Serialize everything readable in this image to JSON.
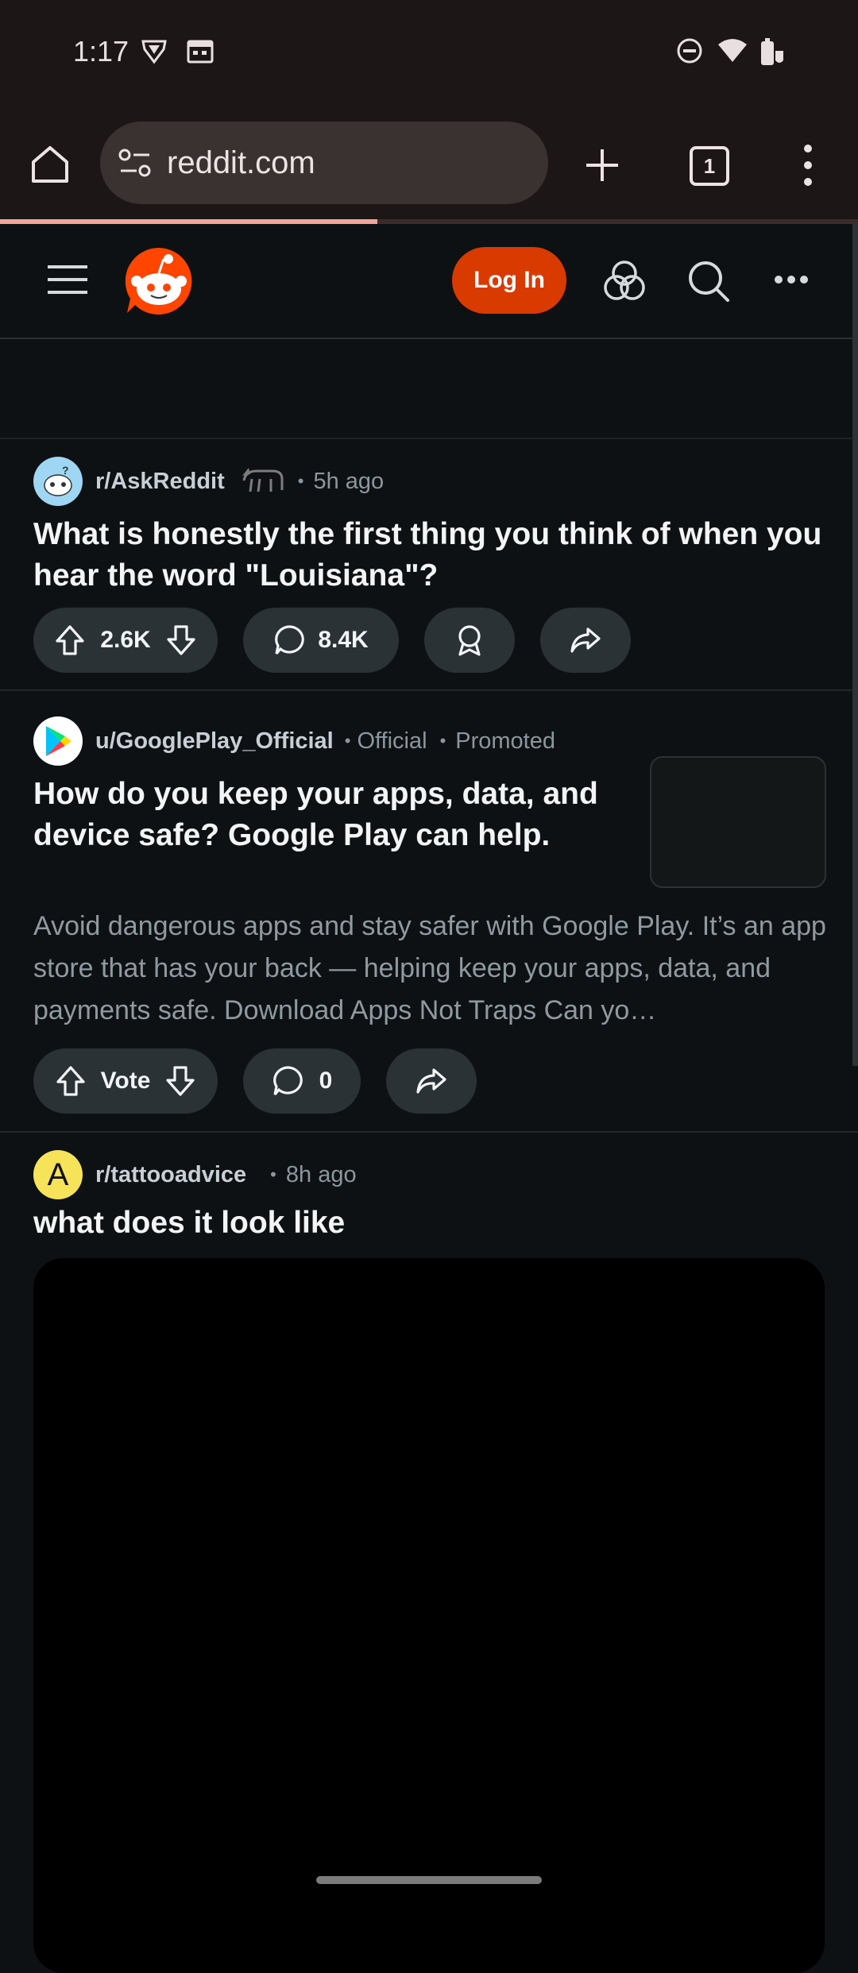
{
  "status_bar": {
    "time": "1:17"
  },
  "browser": {
    "url": "reddit.com",
    "tab_count": "1",
    "load_progress": 0.44
  },
  "reddit_header": {
    "login_label": "Log In"
  },
  "posts": [
    {
      "community": "r/AskReddit",
      "time_ago": "5h ago",
      "title": "What is honestly the first thing you think of when you hear the word \"Louisiana\"?",
      "votes": "2.6K",
      "comments": "8.4K"
    },
    {
      "author": "u/GooglePlay_Official",
      "official_label": "Official",
      "promoted_label": "Promoted",
      "title": "How do you keep your apps, data, and device safe? Google Play can help.",
      "body": "Avoid dangerous apps and stay safer with Google Play. It’s an app store that has your back — helping keep your apps, data, and payments safe. Download Apps Not Traps Can yo…",
      "votes": "Vote",
      "comments": "0"
    },
    {
      "community": "r/tattooadvice",
      "avatar_letter": "A",
      "time_ago": "8h ago",
      "title": "what does it look like"
    }
  ],
  "colors": {
    "brand": "#ff4500",
    "login": "#d93a00",
    "background": "#0e1113"
  }
}
